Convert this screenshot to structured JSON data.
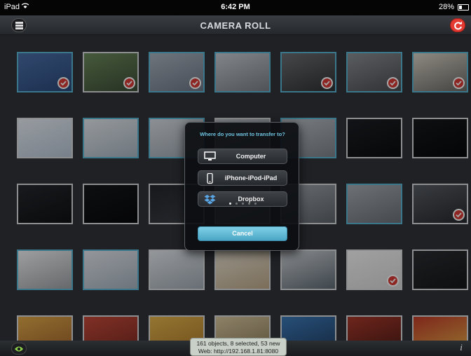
{
  "status_bar": {
    "carrier": "iPad",
    "time": "6:42 PM",
    "battery": "28%"
  },
  "nav": {
    "title": "CAMERA ROLL",
    "menu_icon": "list-icon",
    "refresh_icon": "refresh-icon"
  },
  "photos": [
    {
      "selected": true,
      "checked": true,
      "colors": [
        "#4b6fa8",
        "#2c4a7a"
      ]
    },
    {
      "selected": false,
      "checked": true,
      "colors": [
        "#6c8a5c",
        "#3c4d36"
      ]
    },
    {
      "selected": true,
      "checked": true,
      "colors": [
        "#a9b4c0",
        "#6e7886"
      ]
    },
    {
      "selected": true,
      "checked": false,
      "colors": [
        "#c8ccd2",
        "#7a7f87"
      ]
    },
    {
      "selected": true,
      "checked": true,
      "colors": [
        "#6b6e72",
        "#2f3134"
      ]
    },
    {
      "selected": true,
      "checked": true,
      "colors": [
        "#8c9094",
        "#4a4d52"
      ]
    },
    {
      "selected": true,
      "checked": true,
      "colors": [
        "#d9d4c8",
        "#6c6a66"
      ]
    },
    {
      "selected": false,
      "checked": false,
      "colors": [
        "#e8eef5",
        "#b8c6d6"
      ]
    },
    {
      "selected": true,
      "checked": false,
      "colors": [
        "#e4e9ee",
        "#a9b6c2"
      ]
    },
    {
      "selected": true,
      "checked": false,
      "colors": [
        "#d8dde3",
        "#9aa4ae"
      ]
    },
    {
      "selected": false,
      "checked": false,
      "colors": [
        "#c6ccd2",
        "#8a9098"
      ]
    },
    {
      "selected": true,
      "checked": false,
      "colors": [
        "#b9bfc6",
        "#7d838a"
      ]
    },
    {
      "selected": false,
      "checked": false,
      "colors": [
        "#1c1f24",
        "#0b0c0e"
      ]
    },
    {
      "selected": false,
      "checked": false,
      "colors": [
        "#16181c",
        "#07080a"
      ]
    },
    {
      "selected": false,
      "checked": false,
      "colors": [
        "#25282d",
        "#101114"
      ]
    },
    {
      "selected": false,
      "checked": false,
      "colors": [
        "#15171a",
        "#08090b"
      ]
    },
    {
      "selected": false,
      "checked": false,
      "colors": [
        "#23262b",
        "#3a3e44"
      ]
    },
    {
      "selected": false,
      "checked": false,
      "colors": [
        "#c0c4c9",
        "#7d8289"
      ]
    },
    {
      "selected": false,
      "checked": false,
      "colors": [
        "#9fa5ac",
        "#5f646b"
      ]
    },
    {
      "selected": true,
      "checked": false,
      "colors": [
        "#a8aeb5",
        "#6b7178"
      ]
    },
    {
      "selected": false,
      "checked": true,
      "colors": [
        "#595d63",
        "#26292d"
      ]
    },
    {
      "selected": true,
      "checked": false,
      "colors": [
        "#f2f3f4",
        "#9da1a6"
      ]
    },
    {
      "selected": true,
      "checked": false,
      "colors": [
        "#e3e8ee",
        "#a6b2be"
      ]
    },
    {
      "selected": false,
      "checked": false,
      "colors": [
        "#e4e8ec",
        "#a0aab4"
      ]
    },
    {
      "selected": false,
      "checked": false,
      "colors": [
        "#e9e2d2",
        "#bda98a"
      ]
    },
    {
      "selected": false,
      "checked": false,
      "colors": [
        "#cfd3d7",
        "#5f6b75"
      ]
    },
    {
      "selected": false,
      "checked": true,
      "colors": [
        "#f7f7f7",
        "#d8d8d8"
      ]
    },
    {
      "selected": false,
      "checked": false,
      "colors": [
        "#2a2d31",
        "#15171a"
      ]
    },
    {
      "selected": false,
      "checked": false,
      "colors": [
        "#e1a94a",
        "#a0632b"
      ]
    },
    {
      "selected": false,
      "checked": false,
      "colors": [
        "#c54a3a",
        "#7a2a22"
      ]
    },
    {
      "selected": false,
      "checked": false,
      "colors": [
        "#e3b54c",
        "#b07a2d"
      ]
    },
    {
      "selected": false,
      "checked": false,
      "colors": [
        "#d9c9a0",
        "#8a7a58"
      ]
    },
    {
      "selected": false,
      "checked": false,
      "colors": [
        "#3d7ab8",
        "#1f3d62"
      ]
    },
    {
      "selected": false,
      "checked": false,
      "colors": [
        "#a83a2c",
        "#4d1a15"
      ]
    },
    {
      "selected": false,
      "checked": false,
      "colors": [
        "#c23c2a",
        "#e6b34a"
      ]
    }
  ],
  "dialog": {
    "title": "Where do you want to transfer to?",
    "options": [
      {
        "label": "Computer",
        "icon": "monitor-icon"
      },
      {
        "label": "iPhone-iPod-iPad",
        "icon": "phone-icon"
      },
      {
        "label": "Dropbox",
        "icon": "dropbox-icon"
      }
    ],
    "page_dots": 5,
    "active_dot": 0,
    "cancel_label": "Cancel"
  },
  "footer": {
    "status_line1": "161 objects, 8 selected, 53 new",
    "status_line2": "Web: http://192.168.1.81:8080",
    "eye_icon": "eye-icon",
    "info_icon": "info-icon"
  }
}
